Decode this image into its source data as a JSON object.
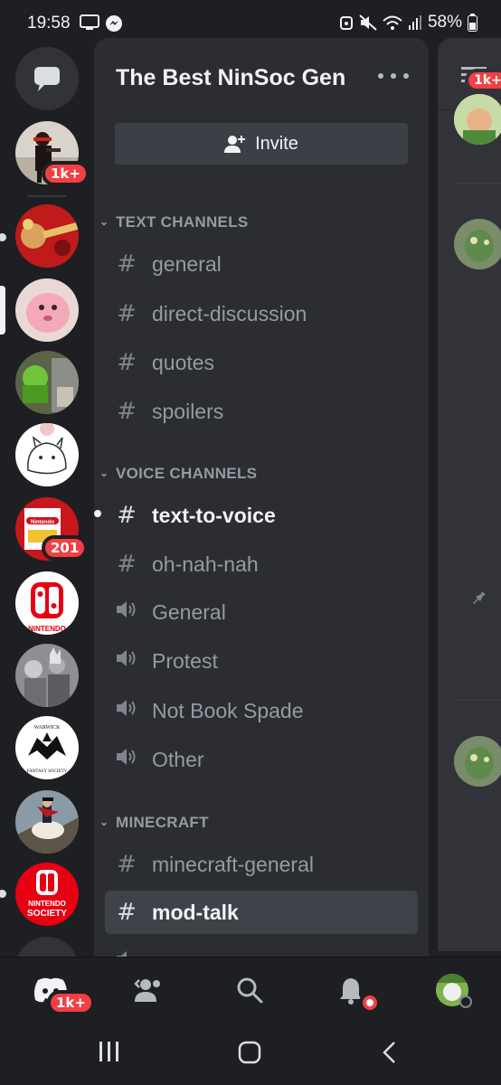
{
  "status_bar": {
    "time": "19:58",
    "battery": "58%"
  },
  "rail": {
    "dm_badge": "1k+",
    "ninsoc_badge": "201",
    "nintendo_society_text": "NINTENDO SOCIETY",
    "warwick_top": "WARWICK",
    "warwick_bottom": "FANTASY SOCIETY"
  },
  "server": {
    "name": "The Best NinSoc Gen",
    "invite_label": "Invite"
  },
  "categories": [
    {
      "label": "TEXT CHANNELS",
      "channels": [
        {
          "label": "general",
          "type": "text"
        },
        {
          "label": "direct-discussion",
          "type": "text"
        },
        {
          "label": "quotes",
          "type": "text"
        },
        {
          "label": "spoilers",
          "type": "text"
        }
      ]
    },
    {
      "label": "VOICE CHANNELS",
      "channels": [
        {
          "label": "text-to-voice",
          "type": "text",
          "unread": true
        },
        {
          "label": "oh-nah-nah",
          "type": "text"
        },
        {
          "label": "General",
          "type": "voice"
        },
        {
          "label": "Protest",
          "type": "voice"
        },
        {
          "label": "Not Book Spade",
          "type": "voice"
        },
        {
          "label": "Other",
          "type": "voice"
        }
      ]
    },
    {
      "label": "MINECRAFT",
      "channels": [
        {
          "label": "minecraft-general",
          "type": "text"
        },
        {
          "label": "mod-talk",
          "type": "text",
          "selected": true
        }
      ]
    }
  ],
  "peek": {
    "badge": "1k+"
  },
  "bottom_nav": {
    "home_badge": "1k+"
  },
  "colors": {
    "background": "#1e1f22",
    "panel": "#2b2d31",
    "selected": "#404249",
    "badge": "#f23f43",
    "muted_text": "#949ba4"
  }
}
